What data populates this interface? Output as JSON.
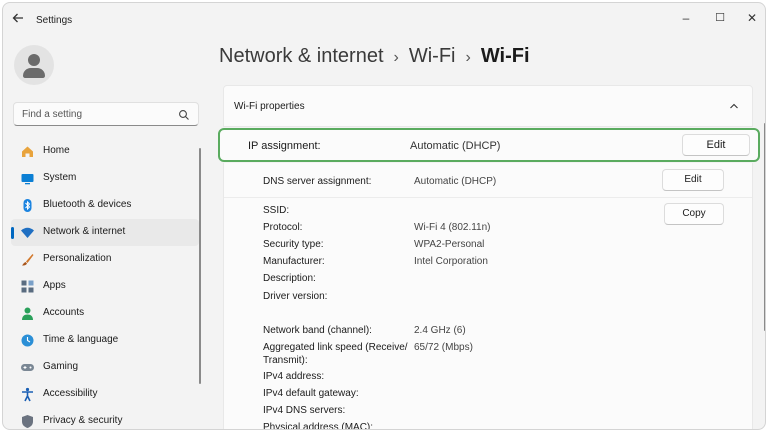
{
  "window": {
    "title": "Settings",
    "minimize": "–",
    "maximize": "☐",
    "close": "✕"
  },
  "search": {
    "placeholder": "Find a setting"
  },
  "sidebar": {
    "items": [
      {
        "label": "Home",
        "icon": "home-icon",
        "color": "#e8a33c"
      },
      {
        "label": "System",
        "icon": "system-icon",
        "color": "#0b7fd4"
      },
      {
        "label": "Bluetooth & devices",
        "icon": "bluetooth-icon",
        "color": "#1a83e0"
      },
      {
        "label": "Network & internet",
        "icon": "wifi-icon",
        "color": "#1f6fc2",
        "active": true
      },
      {
        "label": "Personalization",
        "icon": "brush-icon",
        "color": "#d2782b"
      },
      {
        "label": "Apps",
        "icon": "apps-icon",
        "color": "#5a6c80"
      },
      {
        "label": "Accounts",
        "icon": "accounts-icon",
        "color": "#2aa05a"
      },
      {
        "label": "Time & language",
        "icon": "globe-clock-icon",
        "color": "#2b8fd6"
      },
      {
        "label": "Gaming",
        "icon": "gamepad-icon",
        "color": "#7a8794"
      },
      {
        "label": "Accessibility",
        "icon": "accessibility-icon",
        "color": "#1a5fb4"
      },
      {
        "label": "Privacy & security",
        "icon": "shield-icon",
        "color": "#6b7380"
      }
    ]
  },
  "breadcrumb": {
    "part1": "Network & internet",
    "part2": "Wi-Fi",
    "current": "Wi-Fi",
    "sep": "›"
  },
  "wifi_properties": {
    "title": "Wi-Fi properties",
    "ip_assignment": {
      "label": "IP assignment:",
      "value": "Automatic (DHCP)",
      "button": "Edit"
    },
    "dns_assignment": {
      "label": "DNS server assignment:",
      "value": "Automatic (DHCP)",
      "button": "Edit"
    },
    "copy_button": "Copy",
    "props": [
      {
        "label": "SSID:",
        "value": ""
      },
      {
        "label": "Protocol:",
        "value": "Wi-Fi 4 (802.11n)"
      },
      {
        "label": "Security type:",
        "value": "WPA2-Personal"
      },
      {
        "label": "Manufacturer:",
        "value": "Intel Corporation"
      },
      {
        "label": "Description:",
        "value": ""
      },
      {
        "label": "Driver version:",
        "value": ""
      },
      {
        "label": "Network band (channel):",
        "value": "2.4 GHz (6)"
      },
      {
        "label": "Aggregated link speed (Receive/ Transmit):",
        "value": "65/72 (Mbps)"
      },
      {
        "label": "IPv4 address:",
        "value": ""
      },
      {
        "label": "IPv4 default gateway:",
        "value": ""
      },
      {
        "label": "IPv4 DNS servers:",
        "value": ""
      },
      {
        "label": "Physical address (MAC):",
        "value": ""
      }
    ]
  },
  "colors": {
    "accent": "#0067c0",
    "highlight": "#5aab5f"
  }
}
